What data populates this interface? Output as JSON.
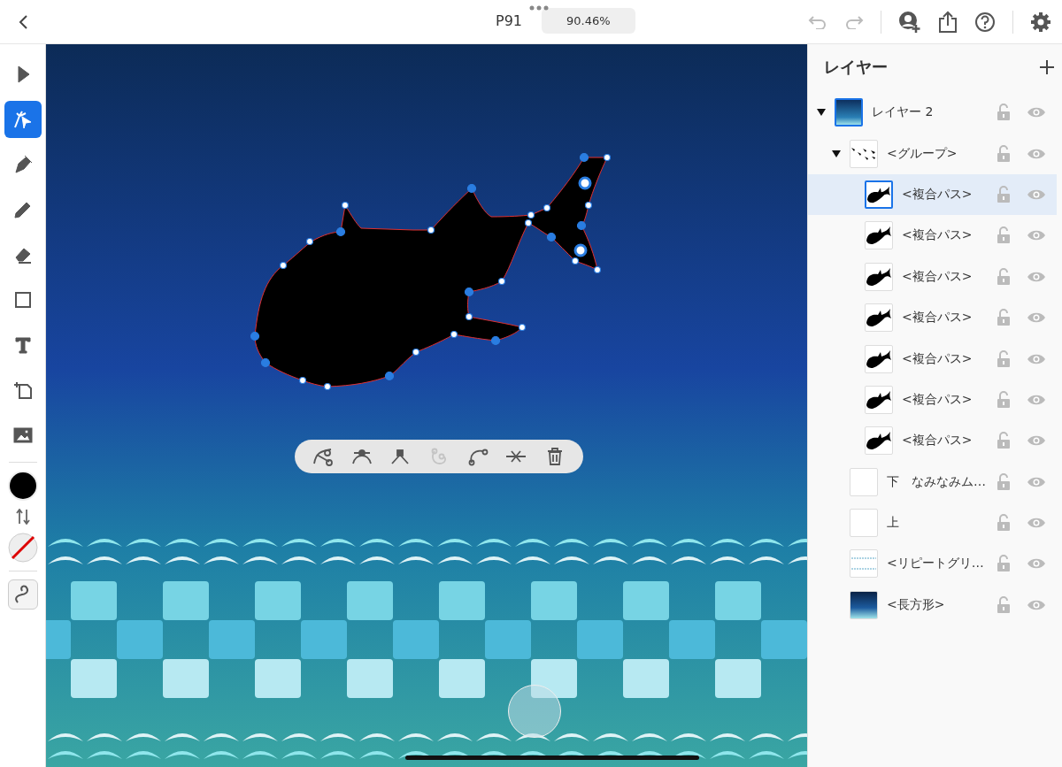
{
  "top_bar": {
    "document_title": "P91",
    "zoom": "90.46%"
  },
  "tools": [
    {
      "kind": "select",
      "selected": false
    },
    {
      "kind": "direct",
      "selected": true
    },
    {
      "kind": "pen",
      "selected": false
    },
    {
      "kind": "pencil",
      "selected": false
    },
    {
      "kind": "eraser",
      "selected": false
    },
    {
      "kind": "shape",
      "selected": false
    },
    {
      "kind": "text",
      "selected": false
    },
    {
      "kind": "transform",
      "selected": false
    },
    {
      "kind": "image",
      "selected": false
    }
  ],
  "path_actions": [
    {
      "kind": "cut",
      "disabled": false
    },
    {
      "kind": "smooth",
      "disabled": false
    },
    {
      "kind": "corner",
      "disabled": false
    },
    {
      "kind": "join",
      "disabled": true
    },
    {
      "kind": "open",
      "disabled": false
    },
    {
      "kind": "remove",
      "disabled": false
    },
    {
      "kind": "delete",
      "disabled": false
    }
  ],
  "layers": {
    "title": "レイヤー",
    "items": [
      {
        "name": "レイヤー 2",
        "kind": "layer",
        "selected": false,
        "expanded": true,
        "children": [
          {
            "name": "<グループ>",
            "kind": "group",
            "selected": false,
            "expanded": true,
            "children": [
              {
                "name": "<複合パス>",
                "kind": "fish",
                "selected": true
              },
              {
                "name": "<複合パス>",
                "kind": "fish",
                "selected": false
              },
              {
                "name": "<複合パス>",
                "kind": "fish",
                "selected": false
              },
              {
                "name": "<複合パス>",
                "kind": "fish",
                "selected": false
              },
              {
                "name": "<複合パス>",
                "kind": "fish",
                "selected": false
              },
              {
                "name": "<複合パス>",
                "kind": "fish",
                "selected": false
              },
              {
                "name": "<複合パス>",
                "kind": "fish",
                "selected": false
              }
            ]
          },
          {
            "name": "下　なみなみム…",
            "kind": "blank",
            "selected": false
          },
          {
            "name": "上",
            "kind": "blank",
            "selected": false
          },
          {
            "name": "<リピートグリ…",
            "kind": "grid",
            "selected": false
          },
          {
            "name": "<長方形>",
            "kind": "rect",
            "selected": false
          }
        ]
      }
    ]
  }
}
